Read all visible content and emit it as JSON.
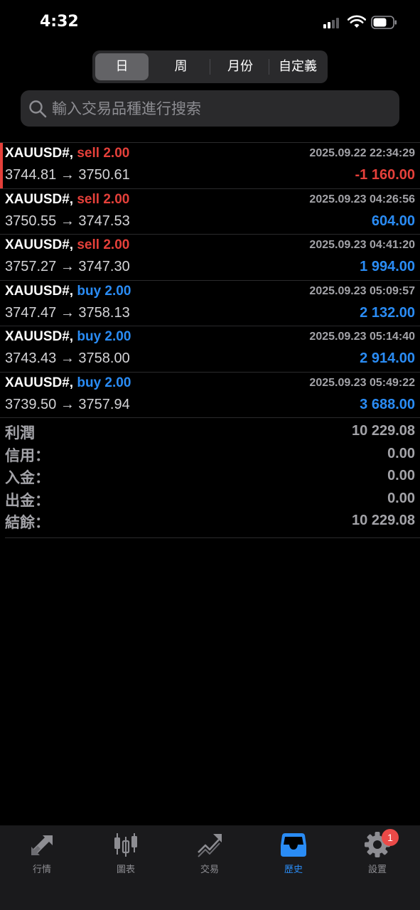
{
  "status_bar": {
    "time": "4:32"
  },
  "period_tabs": [
    {
      "label": "日",
      "active": true
    },
    {
      "label": "周",
      "active": false
    },
    {
      "label": "月份",
      "active": false
    },
    {
      "label": "自定義",
      "active": false
    }
  ],
  "search": {
    "placeholder": "輸入交易品種進行搜索",
    "value": ""
  },
  "trades": [
    {
      "symbol": "XAUUSD#,",
      "side": "sell",
      "volume": "2.00",
      "time": "2025.09.22 22:34:29",
      "open_price": "3744.81",
      "close_price": "3750.61",
      "arrow": "→",
      "profit": "-1 160.00"
    },
    {
      "symbol": "XAUUSD#,",
      "side": "sell",
      "volume": "2.00",
      "time": "2025.09.23 04:26:56",
      "open_price": "3750.55",
      "close_price": "3747.53",
      "arrow": "→",
      "profit": "604.00"
    },
    {
      "symbol": "XAUUSD#,",
      "side": "sell",
      "volume": "2.00",
      "time": "2025.09.23 04:41:20",
      "open_price": "3757.27",
      "close_price": "3747.30",
      "arrow": "→",
      "profit": "1 994.00"
    },
    {
      "symbol": "XAUUSD#,",
      "side": "buy",
      "volume": "2.00",
      "time": "2025.09.23 05:09:57",
      "open_price": "3747.47",
      "close_price": "3758.13",
      "arrow": "→",
      "profit": "2 132.00"
    },
    {
      "symbol": "XAUUSD#,",
      "side": "buy",
      "volume": "2.00",
      "time": "2025.09.23 05:14:40",
      "open_price": "3743.43",
      "close_price": "3758.00",
      "arrow": "→",
      "profit": "2 914.00"
    },
    {
      "symbol": "XAUUSD#,",
      "side": "buy",
      "volume": "2.00",
      "time": "2025.09.23 05:49:22",
      "open_price": "3739.50",
      "close_price": "3757.94",
      "arrow": "→",
      "profit": "3 688.00"
    }
  ],
  "summary": [
    {
      "label": "利潤",
      "value": "10 229.08"
    },
    {
      "label": "信用：",
      "value": "0.00"
    },
    {
      "label": "入金：",
      "value": "0.00"
    },
    {
      "label": "出金：",
      "value": "0.00"
    },
    {
      "label": "結餘：",
      "value": "10 229.08"
    }
  ],
  "tab_bar": {
    "items": [
      {
        "label": "行情",
        "icon": "quotes-arrows-icon",
        "active": false
      },
      {
        "label": "圖表",
        "icon": "candlestick-chart-icon",
        "active": false
      },
      {
        "label": "交易",
        "icon": "trade-trend-icon",
        "active": false
      },
      {
        "label": "歷史",
        "icon": "history-tray-icon",
        "active": true
      },
      {
        "label": "設置",
        "icon": "settings-gear-icon",
        "active": false,
        "badge": "1"
      }
    ]
  },
  "colors": {
    "sell": "#e5403a",
    "buy": "#2a8cf5",
    "negative": "#e5403a",
    "positive": "#2a8cf5",
    "active_tab": "#2a8cf5",
    "badge": "#ea4a48"
  }
}
